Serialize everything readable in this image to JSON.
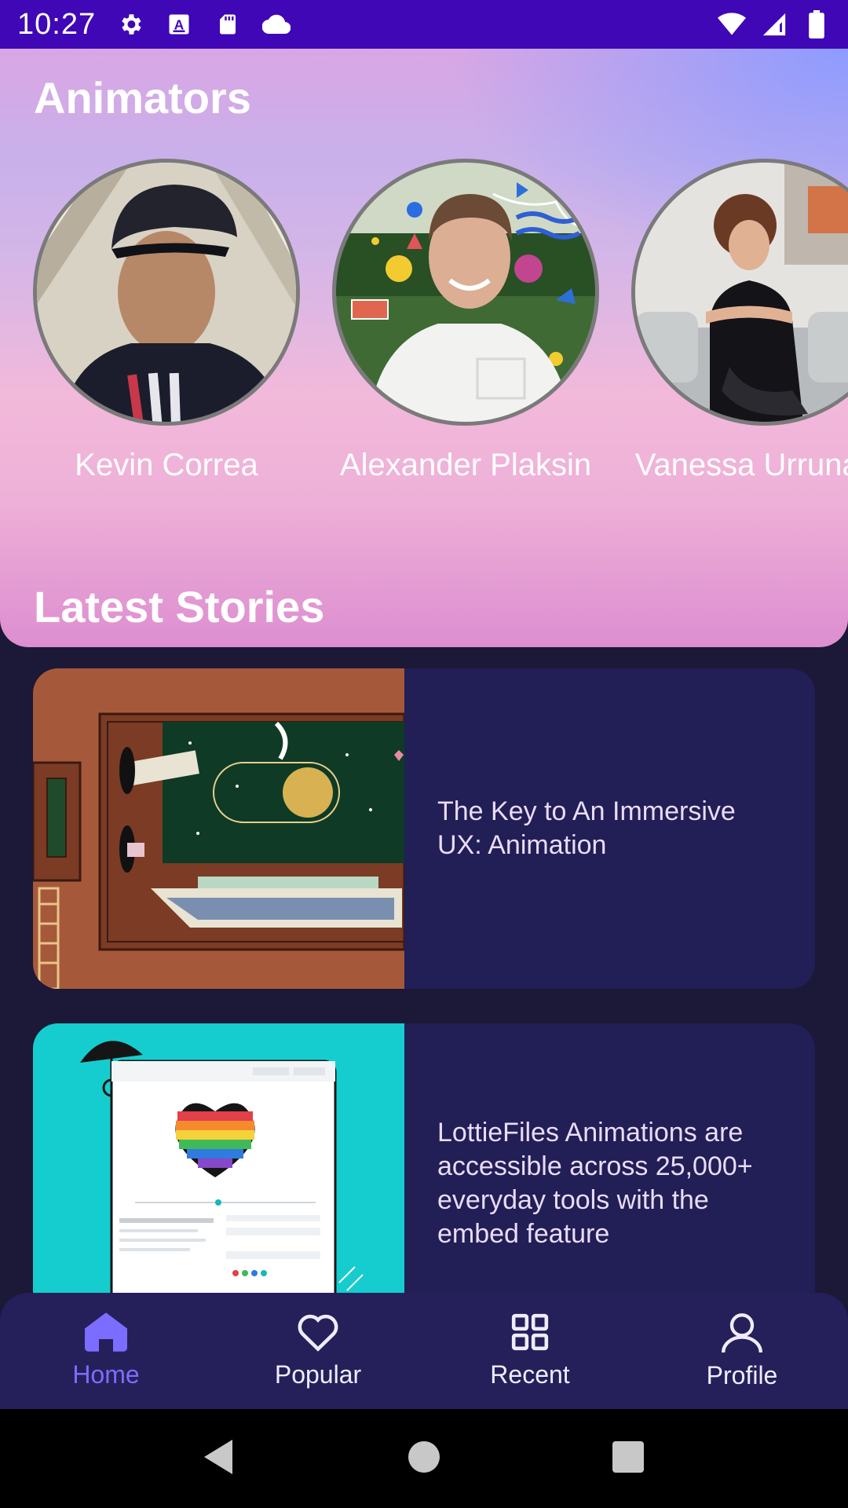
{
  "status_bar": {
    "time": "10:27",
    "left_icons": [
      "gear-icon",
      "a-box-icon",
      "sd-card-icon",
      "cloud-icon"
    ],
    "right_icons": [
      "wifi-icon",
      "signal-icon",
      "battery-icon"
    ]
  },
  "header": {
    "animators_title": "Animators",
    "stories_title": "Latest Stories"
  },
  "animators": [
    {
      "name": "Kevin Correa"
    },
    {
      "name": "Alexander Plaksin"
    },
    {
      "name": "Vanessa Urrunaga"
    }
  ],
  "stories": [
    {
      "title": "The Key to An Immersive UX: Animation"
    },
    {
      "title": "LottieFiles Animations are accessible across 25,000+ everyday tools with the embed feature"
    }
  ],
  "bottom_nav": {
    "items": [
      {
        "label": "Home",
        "icon": "home-icon",
        "active": true
      },
      {
        "label": "Popular",
        "icon": "heart-icon",
        "active": false
      },
      {
        "label": "Recent",
        "icon": "grid-icon",
        "active": false
      },
      {
        "label": "Profile",
        "icon": "person-icon",
        "active": false
      }
    ]
  },
  "colors": {
    "status_bar": "#3f07b5",
    "background": "#1c1838",
    "card": "#221e56",
    "nav": "#25205a",
    "active": "#7b6dff"
  }
}
